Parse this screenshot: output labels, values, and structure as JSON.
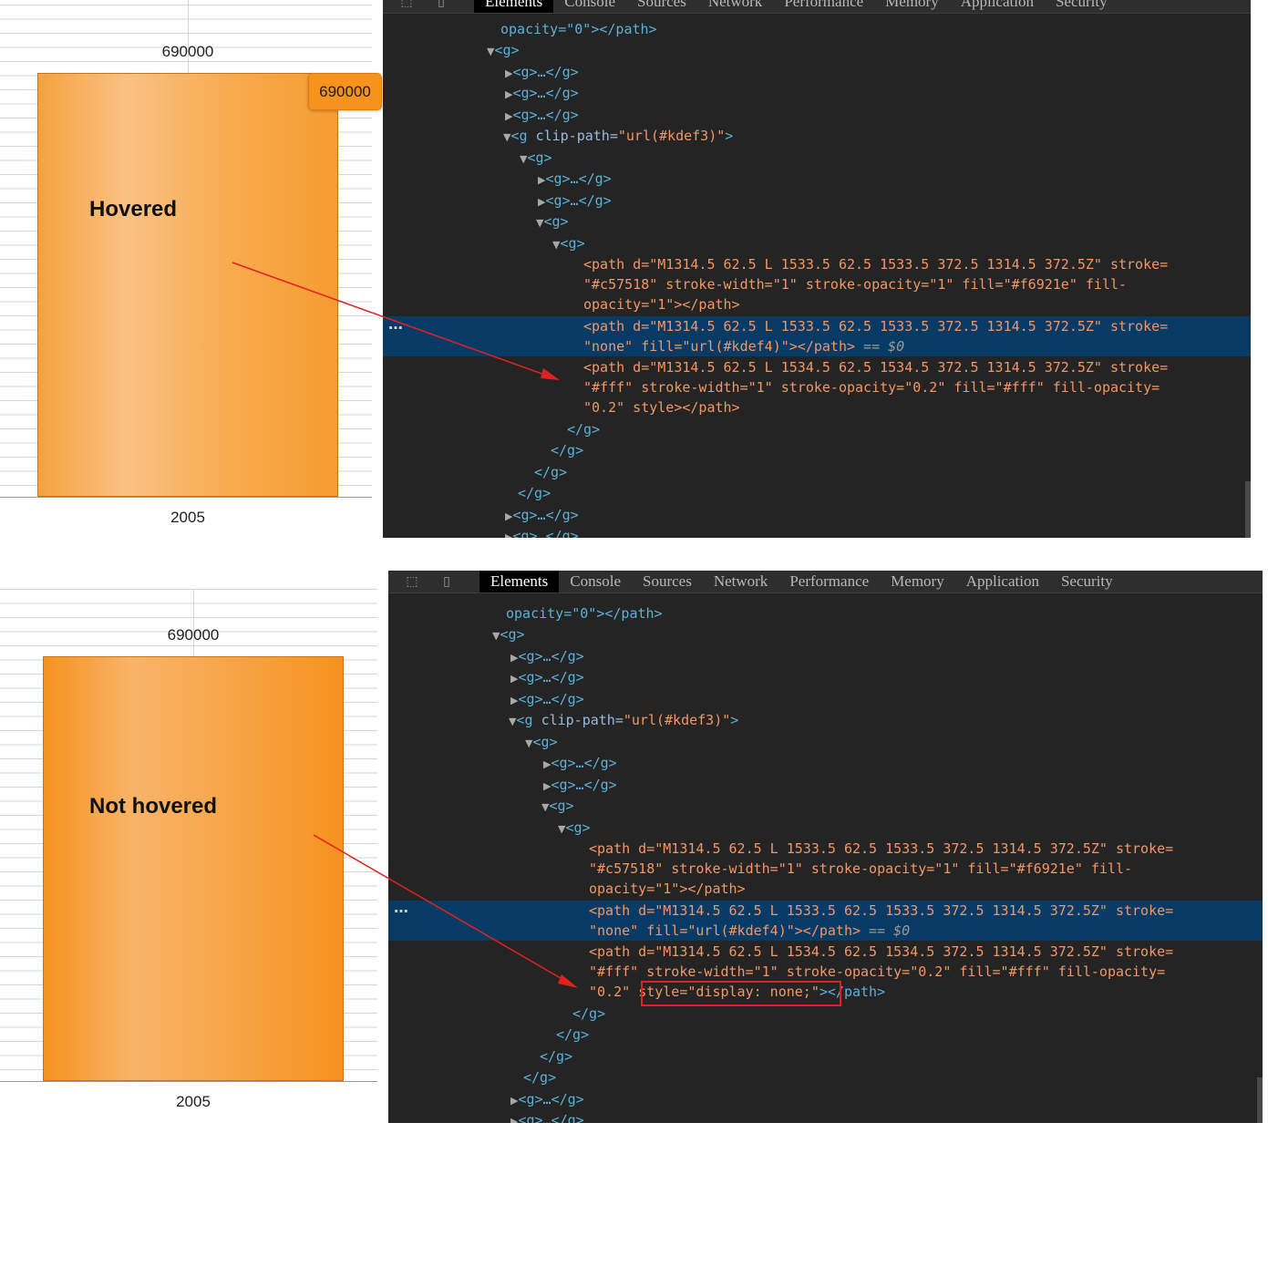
{
  "colors": {
    "bar_fill": "#f6921e",
    "bar_stroke": "#c57518",
    "tooltip_bg": "#f6921e",
    "devtools_bg": "#242424",
    "highlight_row": "#073b66",
    "arrow": "#e12121"
  },
  "devtools": {
    "tabs": [
      "Elements",
      "Console",
      "Sources",
      "Network",
      "Performance",
      "Memory",
      "Application",
      "Security"
    ],
    "active_tab": "Elements",
    "icons": [
      "inspect-element-icon",
      "device-toolbar-icon"
    ],
    "code": {
      "opacity_tail": "opacity=\"0\"></path>",
      "g_open": "<g>",
      "g_collapsed": "<g>…</g>",
      "clip_open_tag": "<g ",
      "clip_attr": "clip-path=",
      "clip_val": "\"url(#kdef3)\"",
      "g_close": "</g>",
      "path1_line1": "<path d=\"M1314.5 62.5 L 1533.5 62.5 1533.5 372.5 1314.5 372.5Z\" stroke=",
      "path1_line2": "\"#c57518\" stroke-width=\"1\" stroke-opacity=\"1\" fill=\"#f6921e\" fill-",
      "path1_line3": "opacity=\"1\"></path>",
      "path2_line1": "<path d=\"M1314.5 62.5 L 1533.5 62.5 1533.5 372.5 1314.5 372.5Z\" stroke=",
      "path2_line2": "\"none\" fill=\"url(#kdef4)\"></path>",
      "selected_marker": "== $0",
      "path3_line1": "<path d=\"M1314.5 62.5 L 1534.5 62.5 1534.5 372.5 1314.5 372.5Z\" stroke=",
      "path3_line2": "\"#fff\" stroke-width=\"1\" stroke-opacity=\"0.2\" fill=\"#fff\" fill-opacity=",
      "path3_line3_hovered": "\"0.2\" style></path>",
      "path3_style_value": "style=\"display: none;\"",
      "path3_close": "></path>",
      "path3_prefix": "\"0.2\" "
    }
  },
  "panels": {
    "top": {
      "caption": "Hovered",
      "data_label": "690000",
      "tooltip": "690000",
      "category": "2005"
    },
    "bottom": {
      "caption": "Not hovered",
      "data_label": "690000",
      "category": "2005"
    }
  },
  "chart_data": [
    {
      "type": "bar",
      "categories": [
        "2005"
      ],
      "values": [
        690000
      ],
      "hovered": true
    },
    {
      "type": "bar",
      "categories": [
        "2005"
      ],
      "values": [
        690000
      ],
      "hovered": false
    }
  ]
}
